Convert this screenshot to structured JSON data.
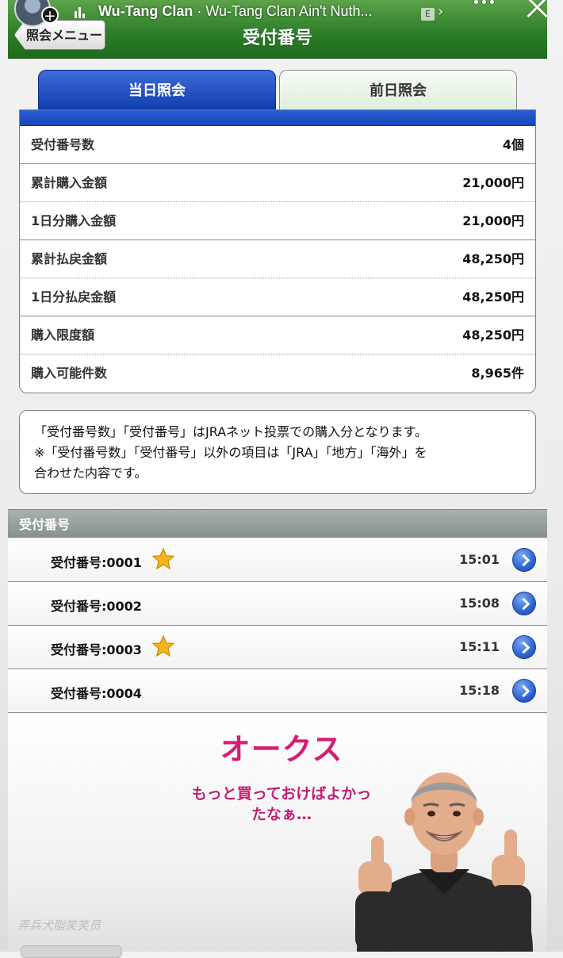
{
  "story": {
    "artist": "Wu-Tang Clan",
    "separator": " · ",
    "song": "Wu-Tang Clan Ain't Nuth...",
    "explicit_badge": "E",
    "chevron": "›"
  },
  "header": {
    "back_label": "照会メニュー",
    "title": "受付番号"
  },
  "tabs": [
    {
      "label": "当日照会",
      "active": true
    },
    {
      "label": "前日照会",
      "active": false
    }
  ],
  "summary": [
    {
      "label": "受付番号数",
      "value": "4個"
    },
    {
      "label": "累計購入金額",
      "value": "21,000円"
    },
    {
      "label": "1日分購入金額",
      "value": "21,000円"
    },
    {
      "label": "累計払戻金額",
      "value": "48,250円"
    },
    {
      "label": "1日分払戻金額",
      "value": "48,250円"
    },
    {
      "label": "購入限度額",
      "value": "48,250円"
    },
    {
      "label": "購入可能件数",
      "value": "8,965件"
    }
  ],
  "notice": {
    "line1": "「受付番号数」「受付番号」はJRAネット投票での購入分となります。",
    "line2": "※「受付番号数」「受付番号」以外の項目は「JRA」「地方」「海外」を",
    "line3": "合わせた内容です。"
  },
  "receipts": {
    "section_title": "受付番号",
    "items": [
      {
        "label": "受付番号:0001",
        "starred": true,
        "time": "15:01"
      },
      {
        "label": "受付番号:0002",
        "starred": false,
        "time": "15:08"
      },
      {
        "label": "受付番号:0003",
        "starred": true,
        "time": "15:11"
      },
      {
        "label": "受付番号:0004",
        "starred": false,
        "time": "15:18"
      }
    ]
  },
  "sticker": {
    "title": "オークス",
    "caption_line1": "もっと買っておけばよかっ",
    "caption_line2": "たなぁ…"
  },
  "footer": {
    "faded_text": "弄兵犬脂笑笑员"
  },
  "colors": {
    "header_green": "#2f7f2a",
    "tab_blue": "#1744ba",
    "sticker_pink": "#d81b74",
    "star_gold": "#f2b51b"
  },
  "icons": {
    "star": "star-icon",
    "arrow": "chevron-right-circle-icon",
    "back": "back-arrow-button"
  }
}
